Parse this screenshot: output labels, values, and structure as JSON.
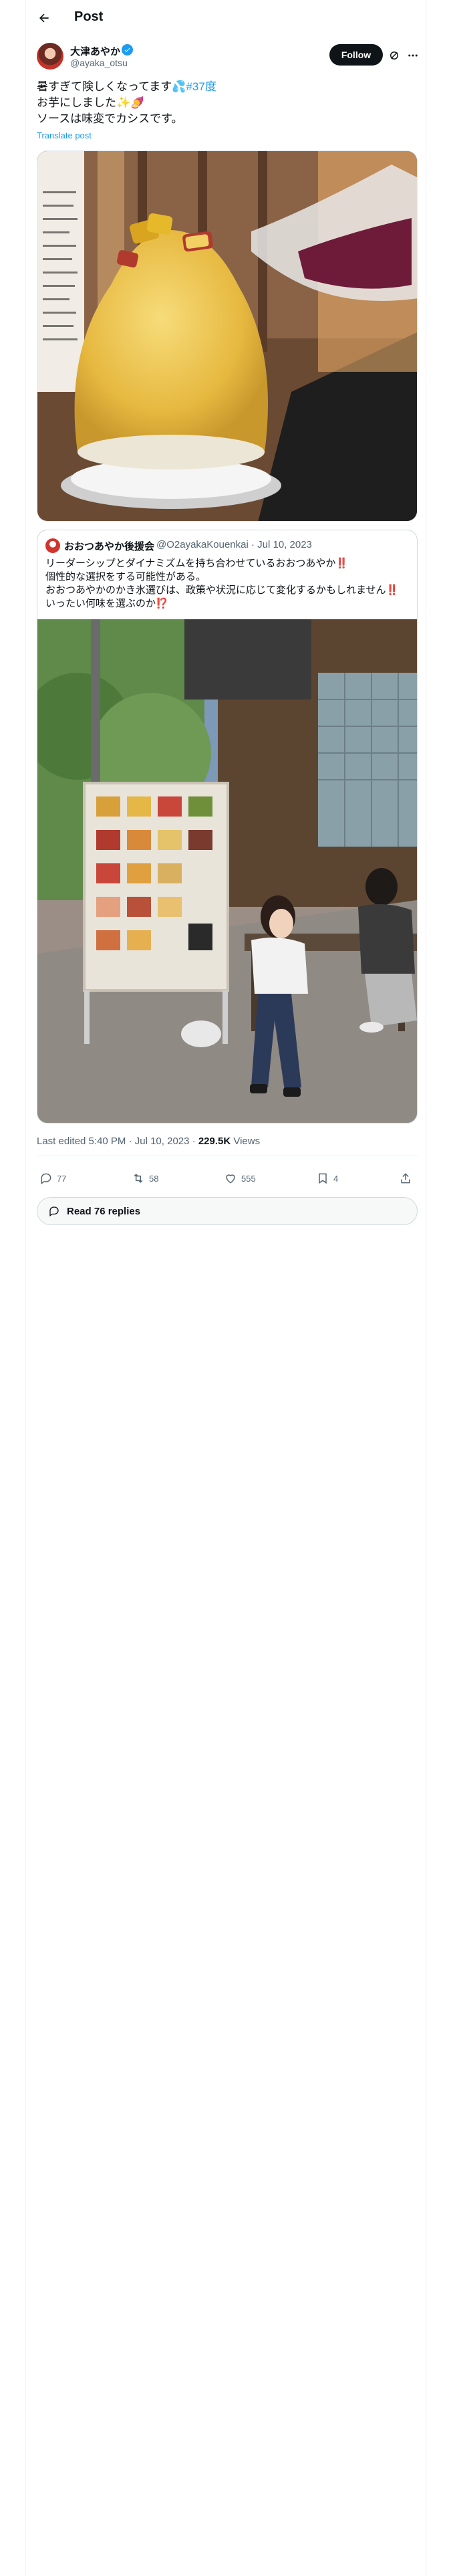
{
  "header": {
    "title": "Post"
  },
  "author": {
    "name": "大津あやか",
    "handle": "@ayaka_otsu",
    "follow_label": "Follow"
  },
  "tweet": {
    "line1": "暑すぎて険しくなってます💦",
    "hashtag": "#37度",
    "line2": "お芋にしました✨🍠",
    "line3": "ソースは味変でカシスです。",
    "translate": "Translate post"
  },
  "quote": {
    "name": "おおつあやか後援会",
    "handle_date": "@O2ayakaKouenkai · Jul 10, 2023",
    "lines": [
      "リーダーシップとダイナミズムを持ち合わせているおおつあやか‼️",
      "個性的な選択をする可能性がある。",
      "おおつあやかのかき氷選びは、政策や状況に応じて変化するかもしれません‼️",
      "いったい何味を選ぶのか⁉️"
    ]
  },
  "meta": {
    "edited": "Last edited 5:40 PM · Jul 10, 2023 · ",
    "views_count": "229.5K",
    "views_label": " Views"
  },
  "actions": {
    "replies": "77",
    "reposts": "58",
    "likes": "555",
    "bookmarks": "4"
  },
  "read_replies": "Read 76 replies",
  "colors": {
    "accent": "#1d9bf0",
    "text": "#0f1419",
    "muted": "#536471",
    "border": "#cfd9de"
  }
}
